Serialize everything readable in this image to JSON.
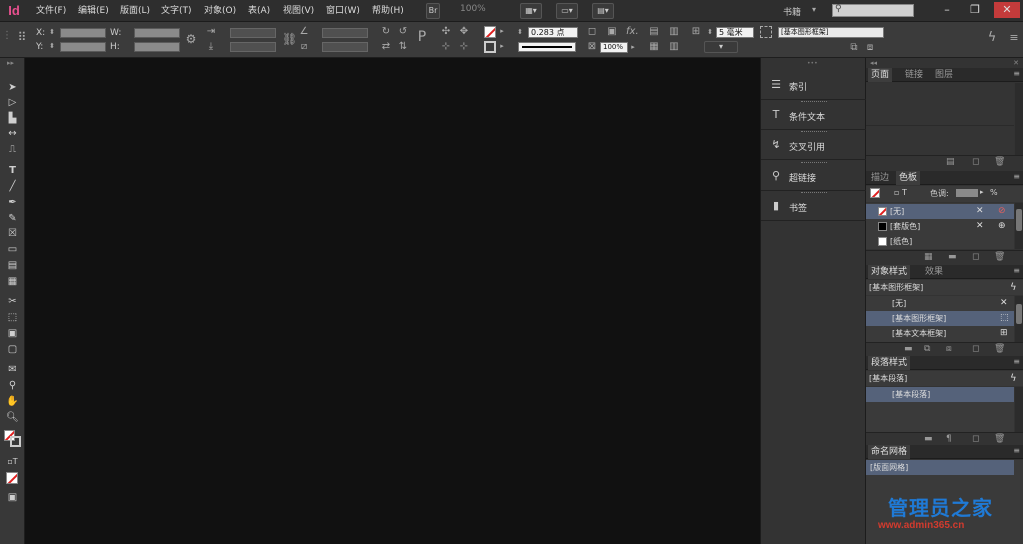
{
  "app": {
    "logo": "Id"
  },
  "menu": [
    "文件(F)",
    "编辑(E)",
    "版面(L)",
    "文字(T)",
    "对象(O)",
    "表(A)",
    "视图(V)",
    "窗口(W)",
    "帮助(H)"
  ],
  "top": {
    "br": "Br",
    "zoom": "100%",
    "workspace": "书籍",
    "search_placeholder": "",
    "window_buttons": [
      "–",
      "❐",
      "✕"
    ]
  },
  "control": {
    "x_label": "X:",
    "y_label": "Y:",
    "w_label": "W:",
    "h_label": "H:",
    "stroke_weight": "0.283 点",
    "opacity": "100%",
    "columns": "5 毫米",
    "object_style": "[基本图形框架]",
    "fx": "fx."
  },
  "mid_panel": {
    "items": [
      {
        "icon": "index-icon",
        "glyph": "☰",
        "label": "索引"
      },
      {
        "icon": "conditional-text-icon",
        "glyph": "T",
        "label": "条件文本"
      },
      {
        "icon": "cross-reference-icon",
        "glyph": "↯",
        "label": "交叉引用"
      },
      {
        "icon": "hyperlink-icon",
        "glyph": "⚲",
        "label": "超链接"
      },
      {
        "icon": "bookmark-icon",
        "glyph": "▮",
        "label": "书签"
      }
    ]
  },
  "pages_panel": {
    "tabs": [
      "页面",
      "链接",
      "图层"
    ]
  },
  "swatches_panel": {
    "tabs": [
      "描边",
      "色板"
    ],
    "tint_label": "色调:",
    "percent": "%",
    "items": [
      {
        "name": "[无]",
        "color": "none",
        "selected": true
      },
      {
        "name": "[套版色]",
        "color": "#000000",
        "selected": false
      },
      {
        "name": "[纸色]",
        "color": "#ffffff",
        "selected": false
      }
    ]
  },
  "object_styles_panel": {
    "tabs": [
      "对象样式",
      "效果"
    ],
    "current": "[基本图形框架]",
    "items": [
      {
        "name": "[无]",
        "selected": false
      },
      {
        "name": "[基本图形框架]",
        "selected": true
      },
      {
        "name": "[基本文本框架]",
        "selected": false
      }
    ]
  },
  "paragraph_styles_panel": {
    "tabs": [
      "段落样式"
    ],
    "current": "[基本段落]",
    "items": [
      {
        "name": "[基本段落]",
        "selected": true
      }
    ]
  },
  "named_grids_panel": {
    "tabs": [
      "命名网格"
    ],
    "items": [
      {
        "name": "[版面网格]",
        "selected": true
      }
    ]
  },
  "watermark": {
    "line1": "管理员之家",
    "line2": "www.admin365.cn",
    "colors": {
      "line1": "#1f7ad6",
      "line2": "#d23b2e"
    }
  }
}
